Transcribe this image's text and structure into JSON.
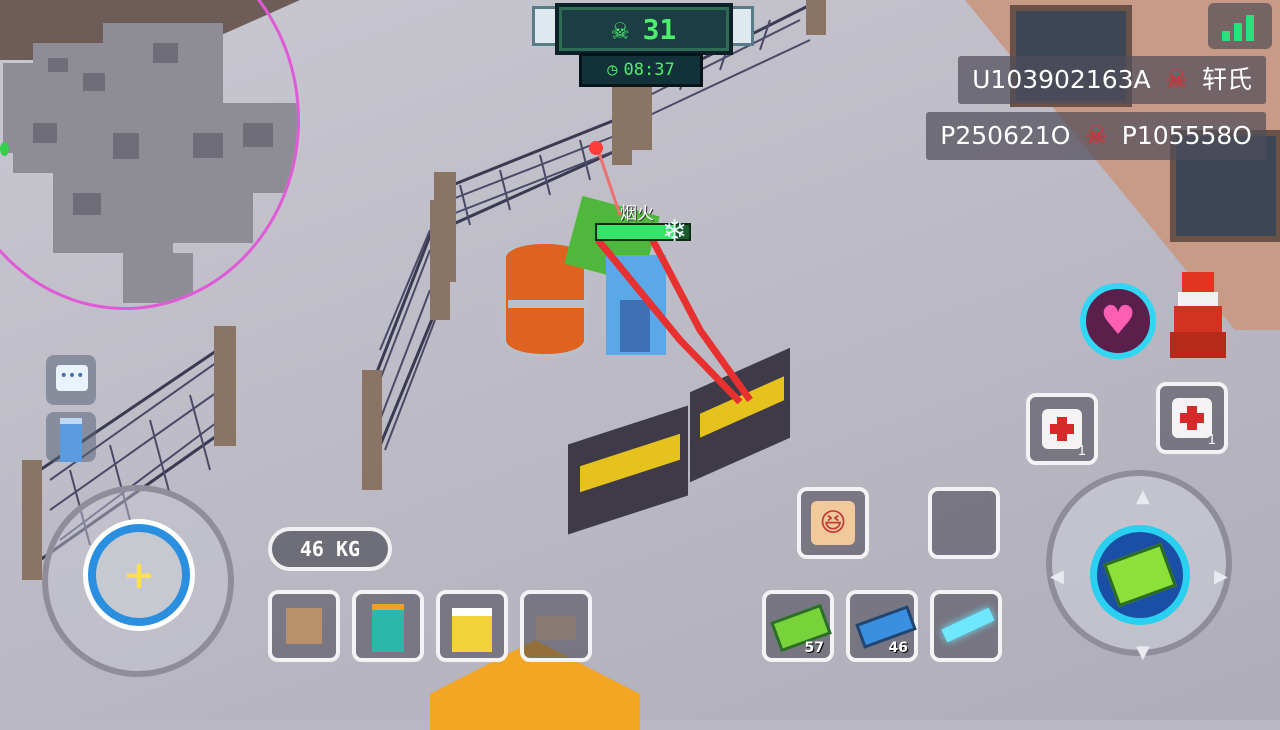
{
  "hud": {
    "alive_count": "31",
    "match_time": "08:37",
    "weight": "46 KG",
    "player_name": "烟火",
    "player_health_fraction": 0.85
  },
  "kill_feed": [
    {
      "killer": "U103902163A",
      "victim": "轩氏"
    },
    {
      "killer": "P250621O",
      "victim": "P105558O"
    }
  ],
  "inventory": {
    "weapons": [
      {
        "icon": "green-blaster-icon",
        "count": "57"
      },
      {
        "icon": "blue-rifle-icon",
        "count": "46"
      },
      {
        "icon": "laser-sword-icon",
        "count": ""
      }
    ],
    "items": [
      {
        "icon": "cardboard-box-icon"
      },
      {
        "icon": "teal-backpack-icon"
      },
      {
        "icon": "gold-armor-icon"
      },
      {
        "icon": "boots-icon"
      }
    ],
    "medkits": [
      {
        "count": "1"
      },
      {
        "count": "1"
      }
    ]
  },
  "icons": {
    "alive": "skull-counter-icon",
    "clock": "clock-icon",
    "signal": "signal-bars-icon",
    "kill": "skull-icon",
    "chat": "chat-bubble-icon",
    "building": "building-icon",
    "heart": "heart-icon",
    "tower": "tower-icon",
    "emote": "laughing-face-icon",
    "fire": "fire-button-icon"
  },
  "colors": {
    "hud_green": "#4df06d",
    "kill_red": "#e1292a",
    "ring_blue": "#2a8fdf",
    "heart_pink": "#ff5fb2",
    "safe_zone_magenta": "#e05ad8"
  }
}
